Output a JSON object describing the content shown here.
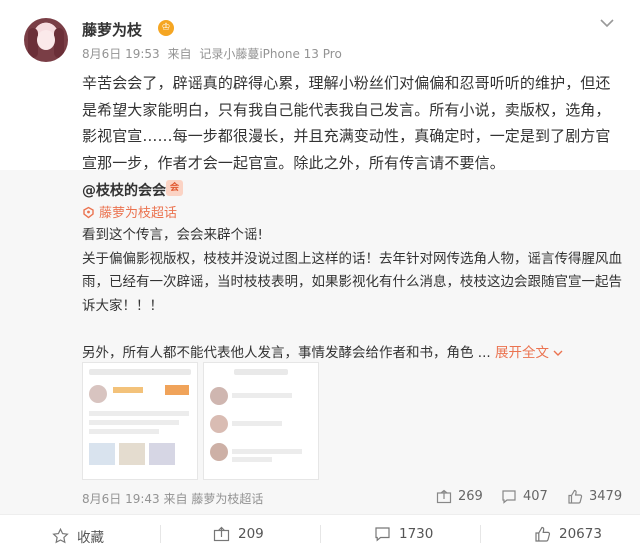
{
  "post": {
    "author": "藤萝为枝",
    "vip_badge": "♔",
    "date": "8月6日 19:53",
    "from_label": "来自",
    "device": "记录小藤蔓iPhone 13 Pro",
    "text": "辛苦会会了，辟谣真的辟得心累，理解小粉丝们对偏偏和忍哥听听的维护，但还是希望大家能明白，只有我自己能代表我自己发言。所有小说，卖版权，选角，影视官宣……每一步都很漫长，并且充满变动性，真确定时，一定是到了剧方官宣那一步，作者才会一起官宣。除此之外，所有传言请不要信。"
  },
  "repost": {
    "author": "@枝枝的会会",
    "badge": "会",
    "topic": "藤萝为枝超话",
    "line1": "看到这个传言，会会来辟个谣!",
    "line2": "关于偏偏影视版权，枝枝并没说过图上这样的话！去年针对网传选角人物，谣言传得腥风血雨，已经有一次辟谣，当时枝枝表明，如果影视化有什么消息，枝枝这边会跟随官宣一起告诉大家！！！",
    "line3": "另外，所有人都不能代表他人发言，事情发酵会给作者和书，角色 ...",
    "expand": "展开全文",
    "date": "8月6日 19:43",
    "from_label": "来自",
    "source": "藤萝为枝超话",
    "shares": "269",
    "comments": "407",
    "likes": "3479"
  },
  "bottom": {
    "favorite": "收藏",
    "reposts": "209",
    "comments": "1730",
    "likes": "20673"
  },
  "icons": {
    "more": "chevron-down-icon",
    "share": "share-icon",
    "comment": "comment-icon",
    "like": "thumbs-up-icon",
    "favorite": "star-icon"
  },
  "colors": {
    "accent": "#eb7350",
    "vip": "#f5a623",
    "meta": "#939393",
    "repost_bg": "#f7f7f7"
  }
}
